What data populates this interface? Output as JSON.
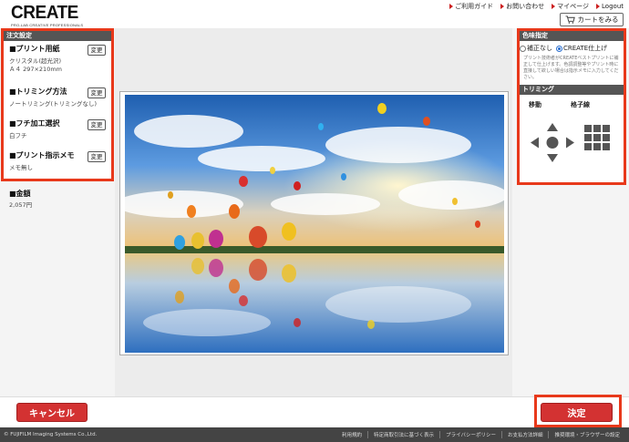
{
  "header": {
    "logo_main": "CREATE",
    "logo_sub": "PRO-LAB CREATIVE PROFESSIONALS",
    "nav": [
      {
        "label": "ご利用ガイド"
      },
      {
        "label": "お問い合わせ"
      },
      {
        "label": "マイページ"
      },
      {
        "label": "Logout"
      }
    ],
    "cart_label": "カートをみる"
  },
  "order_settings": {
    "title": "注文設定",
    "change_label": "変更",
    "print_paper": {
      "title": "■プリント用紙",
      "detail_1": "クリスタル(超光沢)",
      "detail_2": "Ａ４ 297×210mm"
    },
    "trimming_method": {
      "title": "■トリミング方法",
      "detail": "ノートリミング(トリミングなし)"
    },
    "border": {
      "title": "■フチ加工選択",
      "detail": "白フチ"
    },
    "print_memo": {
      "title": "■プリント指示メモ",
      "detail": "メモ無し"
    }
  },
  "amount": {
    "title": "■金額",
    "value": "2,057円"
  },
  "color_settings": {
    "title": "色味指定",
    "option_none": "補正なし",
    "option_create": "CREATE仕上げ",
    "selected": "CREATE仕上げ",
    "note": "プリント技術者がCREATEベストプリントに補正して仕上げます。色調調整等やプリント時に直接して欲しい場合は指示メモに入力してください。"
  },
  "trimming": {
    "title": "トリミング",
    "move_label": "移動",
    "grid_label": "格子線"
  },
  "actions": {
    "cancel_label": "キャンセル",
    "ok_label": "決定"
  },
  "footer": {
    "copyright": "© FUJIFILM Imaging Systems Co.,Ltd.",
    "links": [
      {
        "label": "利用規約"
      },
      {
        "label": "特定商取引法に基づく表示"
      },
      {
        "label": "プライバシーポリシー"
      },
      {
        "label": "お支払方法詳細"
      },
      {
        "label": "推奨環境・ブラウザーの設定"
      }
    ]
  },
  "colors": {
    "accent_red": "#e8391b",
    "button_red": "#d33232",
    "panel_header": "#555555"
  }
}
